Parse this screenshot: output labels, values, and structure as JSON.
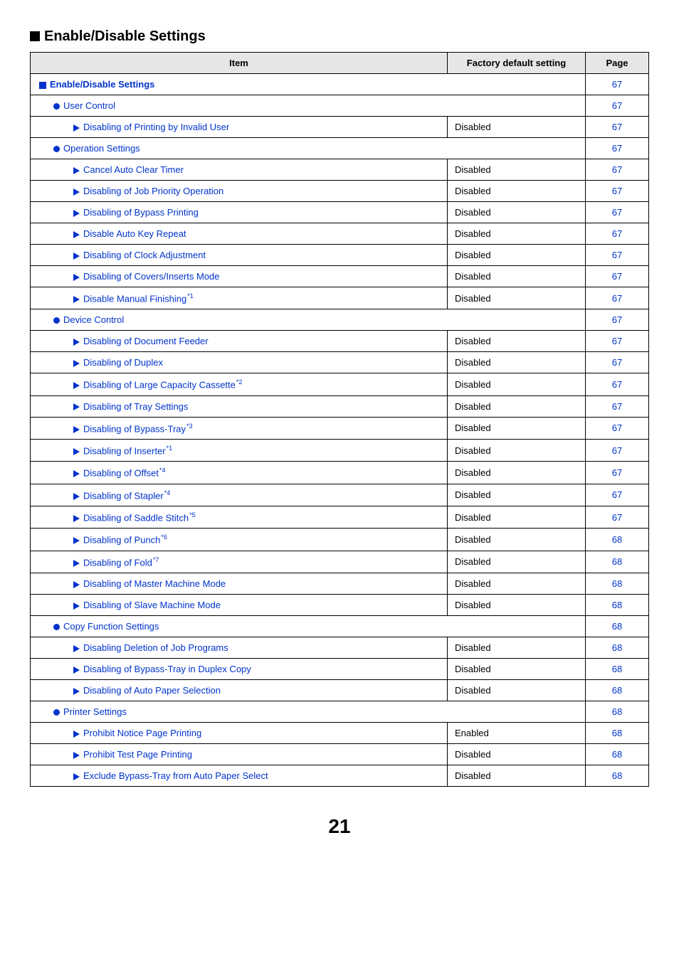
{
  "section_title": "Enable/Disable Settings",
  "columns": {
    "item": "Item",
    "default": "Factory default setting",
    "page": "Page"
  },
  "rows": [
    {
      "type": "section",
      "indent": 0,
      "label": "Enable/Disable Settings",
      "page": "67",
      "span": true,
      "bold": true
    },
    {
      "type": "group",
      "indent": 1,
      "label": "User Control",
      "page": "67",
      "span": true
    },
    {
      "type": "leaf",
      "indent": 2,
      "label": "Disabling of Printing by Invalid User",
      "default": "Disabled",
      "page": "67"
    },
    {
      "type": "group",
      "indent": 1,
      "label": "Operation Settings",
      "page": "67",
      "span": true
    },
    {
      "type": "leaf",
      "indent": 2,
      "label": "Cancel Auto Clear Timer",
      "default": "Disabled",
      "page": "67"
    },
    {
      "type": "leaf",
      "indent": 2,
      "label": "Disabling of Job Priority Operation",
      "default": "Disabled",
      "page": "67"
    },
    {
      "type": "leaf",
      "indent": 2,
      "label": "Disabling of Bypass Printing",
      "default": "Disabled",
      "page": "67"
    },
    {
      "type": "leaf",
      "indent": 2,
      "label": "Disable Auto Key Repeat",
      "default": "Disabled",
      "page": "67"
    },
    {
      "type": "leaf",
      "indent": 2,
      "label": "Disabling of Clock Adjustment",
      "default": "Disabled",
      "page": "67"
    },
    {
      "type": "leaf",
      "indent": 2,
      "label": "Disabling of Covers/Inserts Mode",
      "default": "Disabled",
      "page": "67"
    },
    {
      "type": "leaf",
      "indent": 2,
      "label": "Disable Manual Finishing",
      "sup": "*1",
      "default": "Disabled",
      "page": "67"
    },
    {
      "type": "group",
      "indent": 1,
      "label": "Device Control",
      "page": "67",
      "span": true
    },
    {
      "type": "leaf",
      "indent": 2,
      "label": "Disabling of Document Feeder",
      "default": "Disabled",
      "page": "67"
    },
    {
      "type": "leaf",
      "indent": 2,
      "label": "Disabling of Duplex",
      "default": "Disabled",
      "page": "67"
    },
    {
      "type": "leaf",
      "indent": 2,
      "label": "Disabling of Large Capacity Cassette",
      "sup": "*2",
      "default": "Disabled",
      "page": "67"
    },
    {
      "type": "leaf",
      "indent": 2,
      "label": "Disabling of Tray Settings",
      "default": "Disabled",
      "page": "67"
    },
    {
      "type": "leaf",
      "indent": 2,
      "label": "Disabling of Bypass-Tray",
      "sup": "*3",
      "default": "Disabled",
      "page": "67"
    },
    {
      "type": "leaf",
      "indent": 2,
      "label": "Disabling of Inserter",
      "sup": "*1",
      "default": "Disabled",
      "page": "67"
    },
    {
      "type": "leaf",
      "indent": 2,
      "label": "Disabling of Offset",
      "sup": "*4",
      "default": "Disabled",
      "page": "67"
    },
    {
      "type": "leaf",
      "indent": 2,
      "label": "Disabling of Stapler",
      "sup": "*4",
      "default": "Disabled",
      "page": "67"
    },
    {
      "type": "leaf",
      "indent": 2,
      "label": "Disabling of Saddle Stitch",
      "sup": "*5",
      "default": "Disabled",
      "page": "67"
    },
    {
      "type": "leaf",
      "indent": 2,
      "label": "Disabling of Punch",
      "sup": "*6",
      "default": "Disabled",
      "page": "68"
    },
    {
      "type": "leaf",
      "indent": 2,
      "label": "Disabling of Fold",
      "sup": "*7",
      "default": "Disabled",
      "page": "68"
    },
    {
      "type": "leaf",
      "indent": 2,
      "label": "Disabling of Master Machine Mode",
      "default": "Disabled",
      "page": "68"
    },
    {
      "type": "leaf",
      "indent": 2,
      "label": "Disabling of Slave Machine Mode",
      "default": "Disabled",
      "page": "68"
    },
    {
      "type": "group",
      "indent": 1,
      "label": "Copy Function Settings",
      "page": "68",
      "span": true
    },
    {
      "type": "leaf",
      "indent": 2,
      "label": "Disabling Deletion of Job Programs",
      "default": "Disabled",
      "page": "68"
    },
    {
      "type": "leaf",
      "indent": 2,
      "label": "Disabling of Bypass-Tray in Duplex Copy",
      "default": "Disabled",
      "page": "68"
    },
    {
      "type": "leaf",
      "indent": 2,
      "label": "Disabling of Auto Paper Selection",
      "default": "Disabled",
      "page": "68"
    },
    {
      "type": "group",
      "indent": 1,
      "label": "Printer Settings",
      "page": "68",
      "span": true
    },
    {
      "type": "leaf",
      "indent": 2,
      "label": "Prohibit Notice Page Printing",
      "default": "Enabled",
      "page": "68"
    },
    {
      "type": "leaf",
      "indent": 2,
      "label": "Prohibit Test Page Printing",
      "default": "Disabled",
      "page": "68"
    },
    {
      "type": "leaf",
      "indent": 2,
      "label": "Exclude Bypass-Tray from Auto Paper Select",
      "default": "Disabled",
      "page": "68"
    }
  ],
  "page_number": "21"
}
